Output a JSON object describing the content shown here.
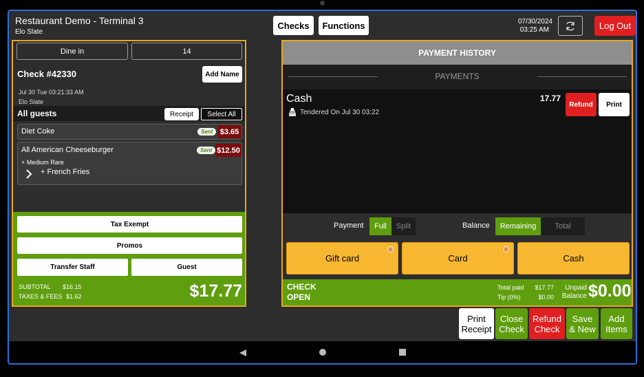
{
  "header": {
    "title": "Restaurant Demo - Terminal 3",
    "subtitle": "Elo Slate",
    "checks_label": "Checks",
    "functions_label": "Functions",
    "date": "07/30/2024",
    "time": "03:25 AM",
    "logout_label": "Log Out"
  },
  "order": {
    "tab_type": "Dine in",
    "tab_number": "14",
    "check_title": "Check #42330",
    "add_name_label": "Add Name",
    "datetime": "Jul 30 Tue 03:21:33 AM",
    "device": "Elo Slate",
    "guests_label": "All guests",
    "receipt_label": "Receipt",
    "select_all_label": "Select All",
    "items": [
      {
        "name": "Diet Coke",
        "status": "Sent",
        "price": "$3.65"
      },
      {
        "name": "All American Cheeseburger",
        "status": "Sent",
        "price": "$12.50",
        "modifiers": [
          "+ Medium Rare",
          "+ French Fries"
        ]
      }
    ],
    "tax_exempt_label": "Tax Exempt",
    "promos_label": "Promos",
    "transfer_staff_label": "Transfer Staff",
    "guest_label": "Guest",
    "subtotal_label": "SUBTOTAL",
    "subtotal_value": "$16.15",
    "taxes_label": "TAXES & FEES",
    "taxes_value": "$1.62",
    "total": "$17.77"
  },
  "payment_history": {
    "title": "PAYMENT HISTORY",
    "section_label": "PAYMENTS",
    "payment_method": "Cash",
    "payment_amount": "17.77",
    "tendered_text": "Tendered On Jul 30 03:22",
    "refund_label": "Refund",
    "print_label": "Print",
    "payment_label": "Payment",
    "full_label": "Full",
    "split_label": "Split",
    "balance_label": "Balance",
    "remaining_label": "Remaining",
    "total_label": "Total",
    "gift_card_label": "Gift card",
    "card_label": "Card",
    "cash_label": "Cash",
    "check_status_line1": "CHECK",
    "check_status_line2": "OPEN",
    "total_paid_label": "Total paid",
    "total_paid_value": "$17.77",
    "tip_label": "Tip (0%)",
    "tip_value": "$0.00",
    "unpaid_label_1": "Unpaid",
    "unpaid_label_2": "Balance",
    "unpaid_value": "$0.00"
  },
  "actions": {
    "print_receipt_1": "Print",
    "print_receipt_2": "Receipt",
    "close_check_1": "Close",
    "close_check_2": "Check",
    "refund_check_1": "Refund",
    "refund_check_2": "Check",
    "save_new_1": "Save",
    "save_new_2": "& New",
    "add_items_1": "Add",
    "add_items_2": "Items"
  },
  "colors": {
    "accent_green": "#5f9e0e",
    "accent_red": "#e02020",
    "accent_orange": "#e8a724",
    "button_yellow": "#f7b731"
  }
}
